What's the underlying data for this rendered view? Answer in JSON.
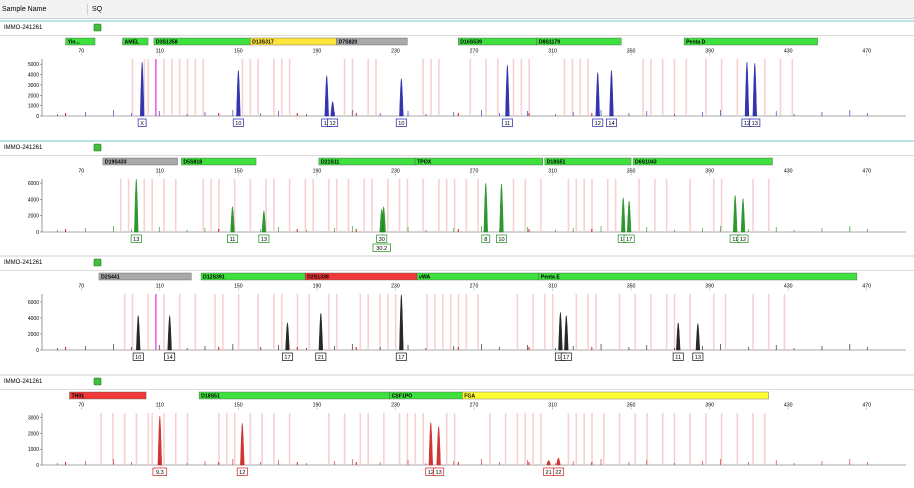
{
  "header": {
    "sample_name_label": "Sample Name",
    "sample_value": "SQ"
  },
  "axis": {
    "ticks": [
      "70",
      "110",
      "150",
      "190",
      "230",
      "270",
      "310",
      "350",
      "390",
      "430",
      "470"
    ]
  },
  "panels": [
    {
      "sample_label": "IMMO-241261",
      "color": "#1f1fa8",
      "y_ticks": [
        "5000",
        "4000",
        "3000",
        "2000",
        "1000",
        "0"
      ],
      "y_max": 5500,
      "markers": [
        {
          "name": "Yin...",
          "start": 62,
          "end": 77,
          "color": "#3ee03e"
        },
        {
          "name": "AMEL",
          "start": 91,
          "end": 104,
          "color": "#3ee03e"
        },
        {
          "name": "D3S1358",
          "start": 107,
          "end": 156,
          "color": "#3ee03e"
        },
        {
          "name": "D13S317",
          "start": 156,
          "end": 200,
          "color": "#ffe43a"
        },
        {
          "name": "D7S820",
          "start": 200,
          "end": 236,
          "color": "#a9a9a9"
        },
        {
          "name": "D16S539",
          "start": 262,
          "end": 302,
          "color": "#3ee03e"
        },
        {
          "name": "D8S1179",
          "start": 302,
          "end": 345,
          "color": "#3ee03e"
        },
        {
          "name": "Penta D",
          "start": 377,
          "end": 445,
          "color": "#3ee03e"
        }
      ],
      "peaks": [
        {
          "x": 101,
          "h": 5200
        },
        {
          "x": 150,
          "h": 4400
        },
        {
          "x": 195,
          "h": 3900
        },
        {
          "x": 198,
          "h": 1400
        },
        {
          "x": 233,
          "h": 3600
        },
        {
          "x": 287,
          "h": 4900
        },
        {
          "x": 333,
          "h": 4200
        },
        {
          "x": 340,
          "h": 4400
        },
        {
          "x": 409,
          "h": 5200
        },
        {
          "x": 413,
          "h": 5100
        }
      ],
      "alleles": [
        {
          "x": 101,
          "labels": [
            "X"
          ]
        },
        {
          "x": 150,
          "labels": [
            "10"
          ]
        },
        {
          "x": 195,
          "labels": [
            "11"
          ]
        },
        {
          "x": 198,
          "labels": [
            "12"
          ]
        },
        {
          "x": 233,
          "labels": [
            "10"
          ]
        },
        {
          "x": 287,
          "labels": [
            "11"
          ]
        },
        {
          "x": 333,
          "labels": [
            "12"
          ]
        },
        {
          "x": 340,
          "labels": [
            "14"
          ]
        },
        {
          "x": 409,
          "labels": [
            "12"
          ]
        },
        {
          "x": 413,
          "labels": [
            "13"
          ]
        }
      ],
      "pink_line_x": 108
    },
    {
      "sample_label": "IMMO-241261",
      "color": "#1a8c1a",
      "y_ticks": [
        "6000",
        "4000",
        "2000",
        "0"
      ],
      "y_max": 6500,
      "markers": [
        {
          "name": "D19S433",
          "start": 81,
          "end": 119,
          "color": "#a9a9a9"
        },
        {
          "name": "D5S818",
          "start": 121,
          "end": 159,
          "color": "#3ee03e"
        },
        {
          "name": "D21S11",
          "start": 191,
          "end": 240,
          "color": "#3ee03e"
        },
        {
          "name": "TPOX",
          "start": 240,
          "end": 305,
          "color": "#3ee03e"
        },
        {
          "name": "D18S51",
          "start": 306,
          "end": 350,
          "color": "#3ee03e"
        },
        {
          "name": "D6S1043",
          "start": 351,
          "end": 422,
          "color": "#3ee03e"
        }
      ],
      "peaks": [
        {
          "x": 98,
          "h": 6500
        },
        {
          "x": 147,
          "h": 3100
        },
        {
          "x": 163,
          "h": 2600
        },
        {
          "x": 223,
          "h": 2800
        },
        {
          "x": 224,
          "h": 3100
        },
        {
          "x": 276,
          "h": 6000
        },
        {
          "x": 284,
          "h": 5900
        },
        {
          "x": 346,
          "h": 4200
        },
        {
          "x": 349,
          "h": 3800
        },
        {
          "x": 403,
          "h": 4500
        },
        {
          "x": 407,
          "h": 4100
        }
      ],
      "alleles": [
        {
          "x": 98,
          "labels": [
            "13"
          ]
        },
        {
          "x": 147,
          "labels": [
            "11"
          ]
        },
        {
          "x": 163,
          "labels": [
            "13"
          ]
        },
        {
          "x": 223,
          "labels": [
            "30",
            "30.2"
          ]
        },
        {
          "x": 276,
          "labels": [
            "8"
          ]
        },
        {
          "x": 284,
          "labels": [
            "10"
          ]
        },
        {
          "x": 346,
          "labels": [
            "16"
          ]
        },
        {
          "x": 349,
          "labels": [
            "17"
          ]
        },
        {
          "x": 403,
          "labels": [
            "11"
          ]
        },
        {
          "x": 407,
          "labels": [
            "12"
          ]
        }
      ]
    },
    {
      "sample_label": "IMMO-241261",
      "color": "#101010",
      "y_ticks": [
        "6000",
        "4000",
        "2000",
        "0"
      ],
      "y_max": 7000,
      "markers": [
        {
          "name": "D2S441",
          "start": 79,
          "end": 126,
          "color": "#a9a9a9"
        },
        {
          "name": "D12S391",
          "start": 131,
          "end": 184,
          "color": "#3ee03e"
        },
        {
          "name": "D2S1338",
          "start": 184,
          "end": 241,
          "color": "#f03838"
        },
        {
          "name": "vWA",
          "start": 241,
          "end": 303,
          "color": "#3ee03e"
        },
        {
          "name": "Penta E",
          "start": 303,
          "end": 465,
          "color": "#3ee03e"
        }
      ],
      "peaks": [
        {
          "x": 99,
          "h": 4300
        },
        {
          "x": 115,
          "h": 4300
        },
        {
          "x": 175,
          "h": 3400
        },
        {
          "x": 192,
          "h": 4600
        },
        {
          "x": 233,
          "h": 6900
        },
        {
          "x": 314,
          "h": 4700
        },
        {
          "x": 317,
          "h": 4300
        },
        {
          "x": 374,
          "h": 3400
        },
        {
          "x": 384,
          "h": 3300
        }
      ],
      "alleles": [
        {
          "x": 99,
          "labels": [
            "10"
          ]
        },
        {
          "x": 115,
          "labels": [
            "14"
          ]
        },
        {
          "x": 175,
          "labels": [
            "17"
          ]
        },
        {
          "x": 192,
          "labels": [
            "21"
          ]
        },
        {
          "x": 233,
          "labels": [
            "17"
          ]
        },
        {
          "x": 314,
          "labels": [
            "16"
          ]
        },
        {
          "x": 317,
          "labels": [
            "17"
          ]
        },
        {
          "x": 374,
          "labels": [
            "11"
          ]
        },
        {
          "x": 384,
          "labels": [
            "13"
          ]
        }
      ],
      "pink_line_x": 108
    },
    {
      "sample_label": "IMMO-241261",
      "color": "#cc1f1f",
      "y_ticks": [
        "3000",
        "2000",
        "1000",
        "0"
      ],
      "y_max": 3300,
      "markers": [
        {
          "name": "TH01",
          "start": 64,
          "end": 103,
          "color": "#f03838"
        },
        {
          "name": "D18S51",
          "start": 130,
          "end": 227,
          "color": "#3ee03e"
        },
        {
          "name": "CSF1PO",
          "start": 227,
          "end": 264,
          "color": "#3ee03e"
        },
        {
          "name": "FGA",
          "start": 264,
          "end": 420,
          "color": "#ffff33"
        }
      ],
      "peaks": [
        {
          "x": 110,
          "h": 3100
        },
        {
          "x": 152,
          "h": 2650
        },
        {
          "x": 248,
          "h": 2700
        },
        {
          "x": 252,
          "h": 2450
        },
        {
          "x": 308,
          "h": 300
        },
        {
          "x": 313,
          "h": 450
        }
      ],
      "alleles": [
        {
          "x": 110,
          "labels": [
            "9.3"
          ]
        },
        {
          "x": 152,
          "labels": [
            "12"
          ]
        },
        {
          "x": 248,
          "labels": [
            "12"
          ]
        },
        {
          "x": 252,
          "labels": [
            "13"
          ]
        },
        {
          "x": 308,
          "labels": [
            "21"
          ]
        },
        {
          "x": 313,
          "labels": [
            "22"
          ]
        }
      ]
    }
  ]
}
